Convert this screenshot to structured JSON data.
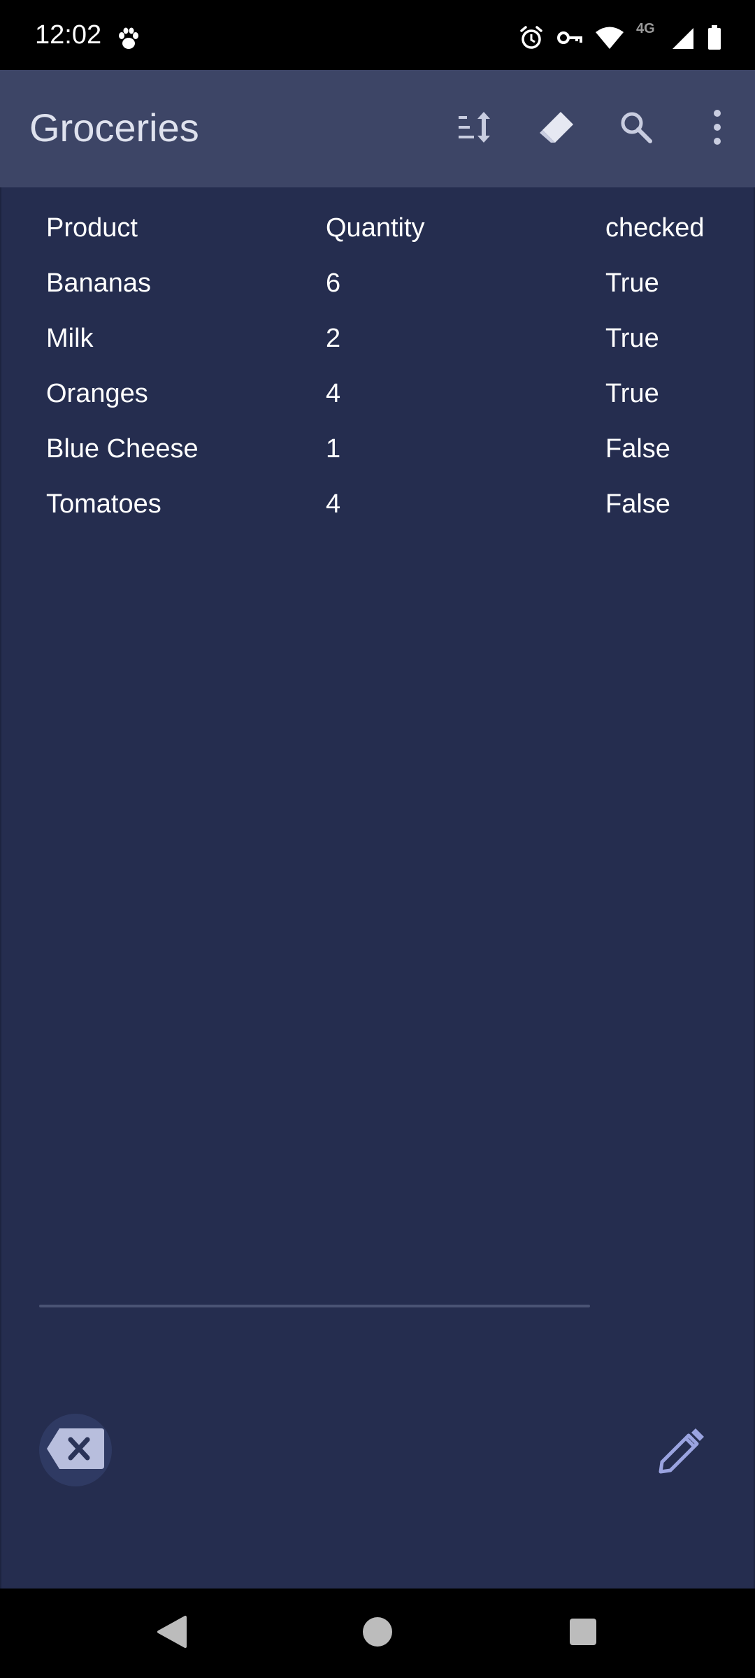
{
  "status_bar": {
    "time": "12:02",
    "network_label": "4G",
    "icons": [
      "paw-icon",
      "alarm-icon",
      "vpn-key-icon",
      "wifi-icon",
      "cellular-signal-icon",
      "battery-icon"
    ]
  },
  "app_bar": {
    "title": "Groceries",
    "actions": [
      "sort-icon",
      "eraser-icon",
      "search-icon",
      "more-vert-icon"
    ]
  },
  "table": {
    "headers": [
      "Product",
      "Quantity",
      "checked"
    ],
    "rows": [
      [
        "Bananas",
        "6",
        "True"
      ],
      [
        "Milk",
        "2",
        "True"
      ],
      [
        "Oranges",
        "4",
        "True"
      ],
      [
        "Blue Cheese",
        "1",
        "False"
      ],
      [
        "Tomatoes",
        "4",
        "False"
      ]
    ]
  },
  "bottom_actions": {
    "clear_icon": "backspace-icon",
    "edit_icon": "pencil-icon"
  },
  "nav_bar": {
    "icons": [
      "back-icon",
      "home-icon",
      "recents-icon"
    ]
  },
  "colors": {
    "app_bar": "#3d4566",
    "background": "#252d4f",
    "accent": "#9aa3e0",
    "text": "#ffffff"
  }
}
